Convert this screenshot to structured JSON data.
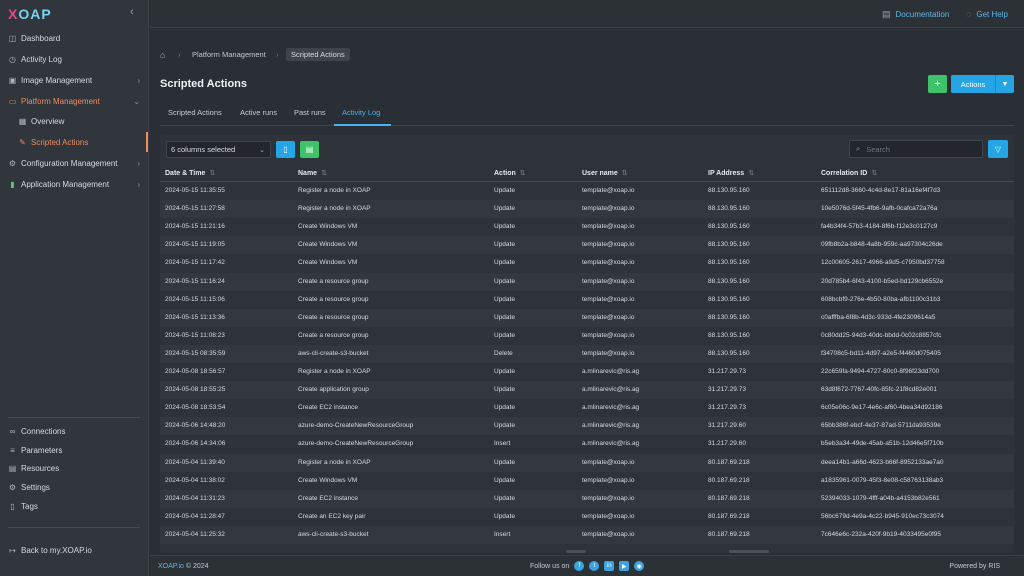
{
  "logo": {
    "x": "X",
    "rest": "OAP"
  },
  "sidebar": {
    "items": [
      {
        "label": "Dashboard",
        "icon": "dashboard-icon",
        "glyph": "◫"
      },
      {
        "label": "Activity Log",
        "icon": "clock-icon",
        "glyph": "◷"
      },
      {
        "label": "Image Management",
        "icon": "image-icon",
        "glyph": "▣"
      },
      {
        "label": "Platform Management",
        "icon": "platform-icon",
        "glyph": "▭"
      },
      {
        "label": "Overview",
        "icon": "grid-icon",
        "glyph": "▦"
      },
      {
        "label": "Scripted Actions",
        "icon": "pencil-icon",
        "glyph": "✎"
      },
      {
        "label": "Configuration Management",
        "icon": "gear-icon",
        "glyph": "⚙"
      },
      {
        "label": "Application Management",
        "icon": "chart-icon",
        "glyph": "▮"
      }
    ],
    "bottom": [
      {
        "label": "Connections",
        "icon": "link-icon",
        "glyph": "∞"
      },
      {
        "label": "Parameters",
        "icon": "list-icon",
        "glyph": "≡"
      },
      {
        "label": "Resources",
        "icon": "stack-icon",
        "glyph": "▤"
      },
      {
        "label": "Settings",
        "icon": "gear-icon",
        "glyph": "⚙"
      },
      {
        "label": "Tags",
        "icon": "bookmark-icon",
        "glyph": "▯"
      }
    ],
    "back": "Back to my.XOAP.io"
  },
  "topbar": {
    "documentation": "Documentation",
    "help": "Get Help"
  },
  "breadcrumb": {
    "platform": "Platform Management",
    "current": "Scripted Actions"
  },
  "page": {
    "title": "Scripted Actions",
    "plus": "+",
    "actions": "Actions"
  },
  "tabs": [
    "Scripted Actions",
    "Active runs",
    "Past runs",
    "Activity Log"
  ],
  "toolbar": {
    "columns": "6 columns selected",
    "search_placeholder": "Search"
  },
  "table": {
    "headers": [
      "Date & Time",
      "Name",
      "Action",
      "User name",
      "IP Address",
      "Correlation ID"
    ],
    "rows": [
      [
        "2024-05-15 11:35:55",
        "Register a node in XOAP",
        "Update",
        "template@xoap.io",
        "88.130.95.160",
        "651112d8-3660-4c4d-8e17-81a16ef4f7d3"
      ],
      [
        "2024-05-15 11:27:58",
        "Register a node in XOAP",
        "Update",
        "template@xoap.io",
        "88.130.95.160",
        "10e5076d-5f45-4fb6-9afb-0cafca72a76a"
      ],
      [
        "2024-05-15 11:21:16",
        "Create Windows VM",
        "Update",
        "template@xoap.io",
        "88.130.95.160",
        "fa4b34f4-57b3-4184-8f6b-f12e3c0127c9"
      ],
      [
        "2024-05-15 11:19:05",
        "Create Windows VM",
        "Update",
        "template@xoap.io",
        "88.130.95.160",
        "09fb8b2a-b848-4a8b-959c-aa97304c26de"
      ],
      [
        "2024-05-15 11:17:42",
        "Create Windows VM",
        "Update",
        "template@xoap.io",
        "88.130.95.160",
        "12c00605-2617-4966-a9d5-c7950bd37758"
      ],
      [
        "2024-05-15 11:16:24",
        "Create a resource group",
        "Update",
        "template@xoap.io",
        "88.130.95.160",
        "20d785b4-6f43-4100-b5ed-bd129cb6552e"
      ],
      [
        "2024-05-15 11:15:06",
        "Create a resource group",
        "Update",
        "template@xoap.io",
        "88.130.95.160",
        "608bcbf9-276e-4b50-80ba-afb1100c31b3"
      ],
      [
        "2024-05-15 11:13:36",
        "Create a resource group",
        "Update",
        "template@xoap.io",
        "88.130.95.160",
        "c0afffba-6f8b-4d3c-933d-4fe2309614a5"
      ],
      [
        "2024-05-15 11:08:23",
        "Create a resource group",
        "Update",
        "template@xoap.io",
        "88.130.95.160",
        "0c80dd25-94d3-40dc-bbdd-0c02c8857cfc"
      ],
      [
        "2024-05-15 08:35:59",
        "aws-cli-create-s3-bucket",
        "Delete",
        "template@xoap.io",
        "88.130.95.160",
        "f34708c5-bd11-4d97-a2e5-f4460d075405"
      ],
      [
        "2024-05-08 18:56:57",
        "Register a node in XOAP",
        "Update",
        "a.mlinarevic@ris.ag",
        "31.217.29.73",
        "22c659fa-9494-4727-80c0-8f96f23dd700"
      ],
      [
        "2024-05-08 18:55:25",
        "Create application group",
        "Update",
        "a.mlinarevic@ris.ag",
        "31.217.29.73",
        "63d8f672-7767-40fc-85fc-21f8cd82e001"
      ],
      [
        "2024-05-08 18:53:54",
        "Create EC2 instance",
        "Update",
        "a.mlinarevic@ris.ag",
        "31.217.29.73",
        "6c05e06c-9e17-4e6c-af60-4bea34d92186"
      ],
      [
        "2024-05-06 14:48:20",
        "azure-demo-CreateNewResourceGroup",
        "Update",
        "a.mlinarevic@ris.ag",
        "31.217.29.60",
        "65bb386f-ebcf-4e37-87ad-5711da93539e"
      ],
      [
        "2024-05-06 14:34:06",
        "azure-demo-CreateNewResourceGroup",
        "Insert",
        "a.mlinarevic@ris.ag",
        "31.217.29.60",
        "b5eb3a34-49de-45ab-a51b-12d46e5f710b"
      ],
      [
        "2024-05-04 11:39:40",
        "Register a node in XOAP",
        "Update",
        "template@xoap.io",
        "80.187.69.218",
        "deea14b1-a66d-4623-b66f-8952133ae7a0"
      ],
      [
        "2024-05-04 11:38:02",
        "Create Windows VM",
        "Update",
        "template@xoap.io",
        "80.187.69.218",
        "a1835961-0079-45f3-8e08-c58763138ab3"
      ],
      [
        "2024-05-04 11:31:23",
        "Create EC2 instance",
        "Update",
        "template@xoap.io",
        "80.187.69.218",
        "52394033-1079-4fff-a04b-a4153b82e561"
      ],
      [
        "2024-05-04 11:28:47",
        "Create an EC2 key pair",
        "Update",
        "template@xoap.io",
        "80.187.69.218",
        "56bc679d-4e9a-4c22-b945-910ec73c3074"
      ],
      [
        "2024-05-04 11:25:32",
        "aws-cli-create-s3-bucket",
        "Insert",
        "template@xoap.io",
        "80.187.69.218",
        "7c646e6c-232a-420f-9b19-4033495e0f95"
      ]
    ]
  },
  "footer": {
    "brand": "XOAP.io",
    "copyright": "© 2024",
    "follow": "Follow us on",
    "powered": "Powered by RIS"
  },
  "colors": {
    "accent": "#24a6e6",
    "active": "#f08a5d",
    "green": "#3fc36a"
  }
}
